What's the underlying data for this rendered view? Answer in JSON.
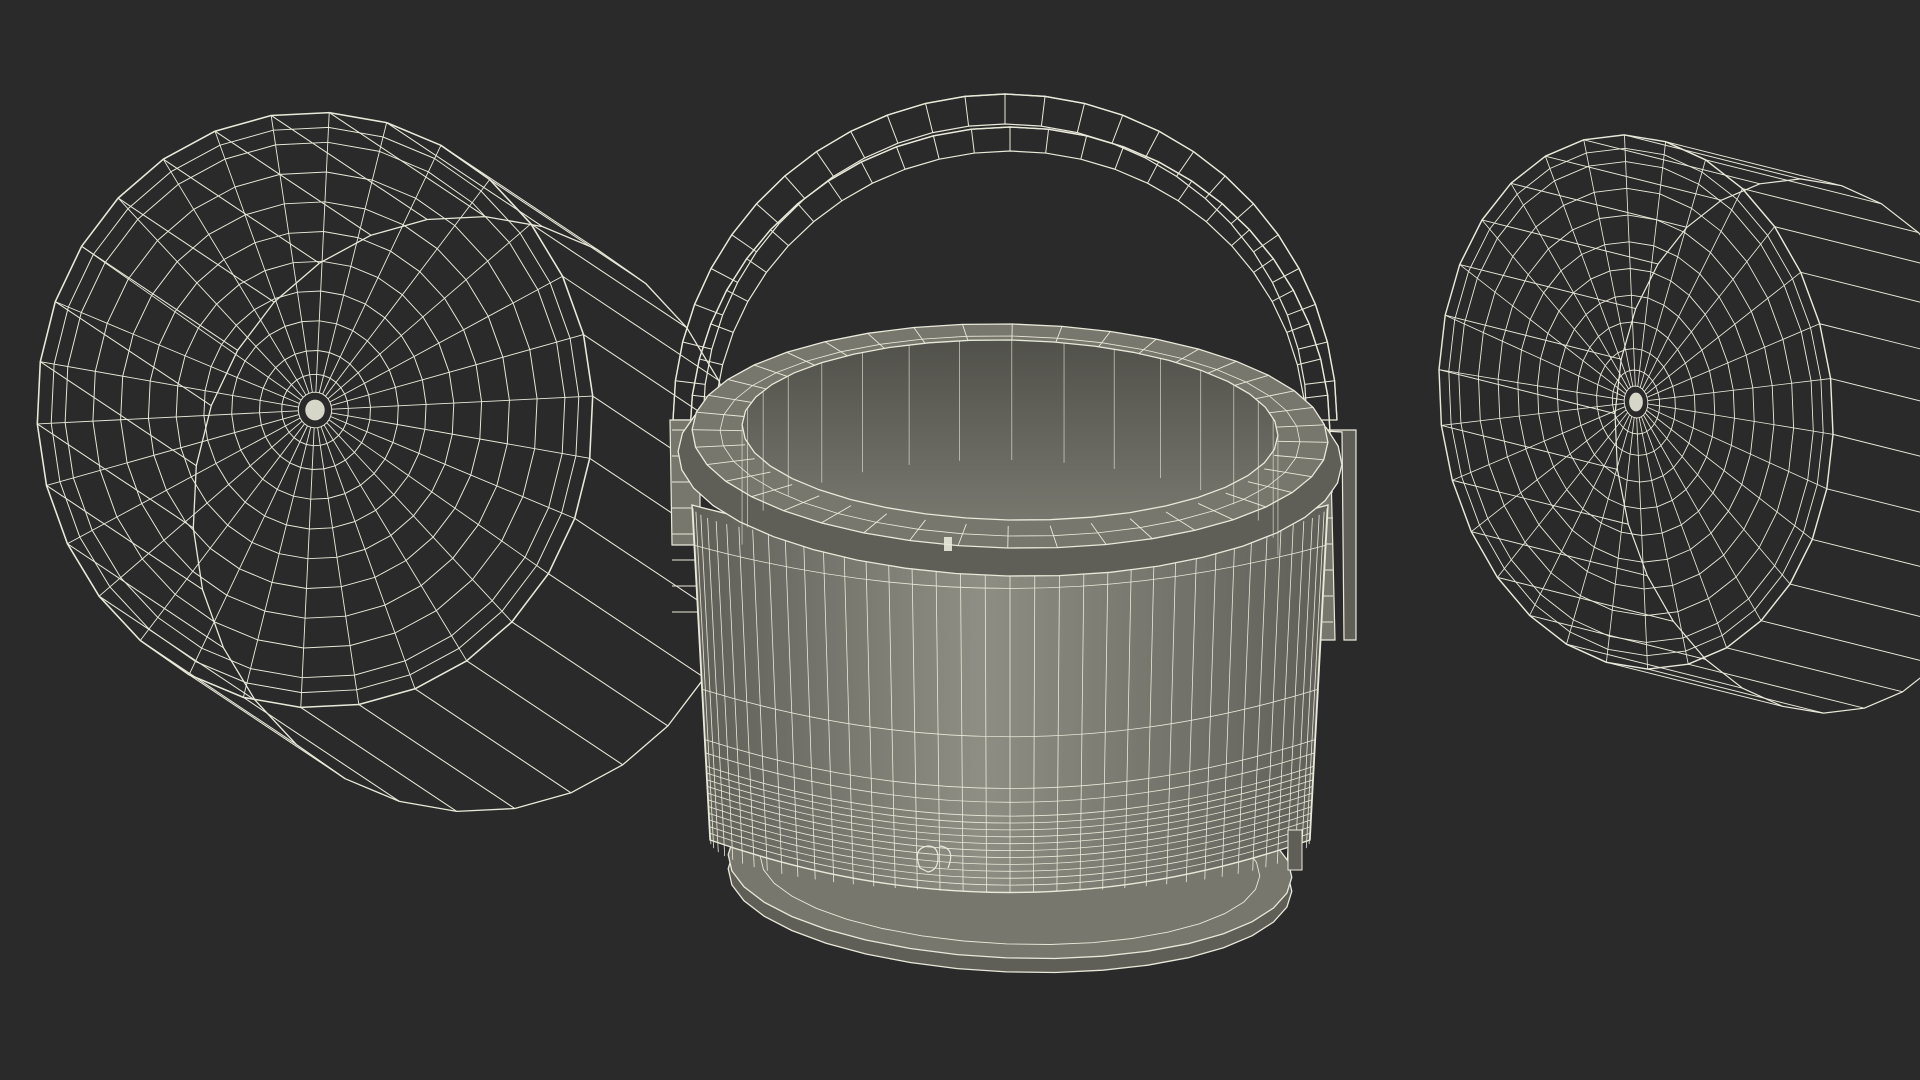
{
  "scene": {
    "view": "wireframe-render",
    "objects": [
      {
        "id": "lid-left",
        "kind": "lid",
        "icon": "dish-icon"
      },
      {
        "id": "bucket",
        "kind": "bucket-with-handle",
        "icon": "bucket-icon"
      },
      {
        "id": "lid-right",
        "kind": "lid",
        "icon": "dish-icon"
      }
    ]
  },
  "colors": {
    "background": "#2a2a2b",
    "surface": "#77776e",
    "surface_dark": "#5f5f58",
    "surface_light": "#8e8e84",
    "wire": "#e9e9da",
    "interior": "#51514b"
  }
}
